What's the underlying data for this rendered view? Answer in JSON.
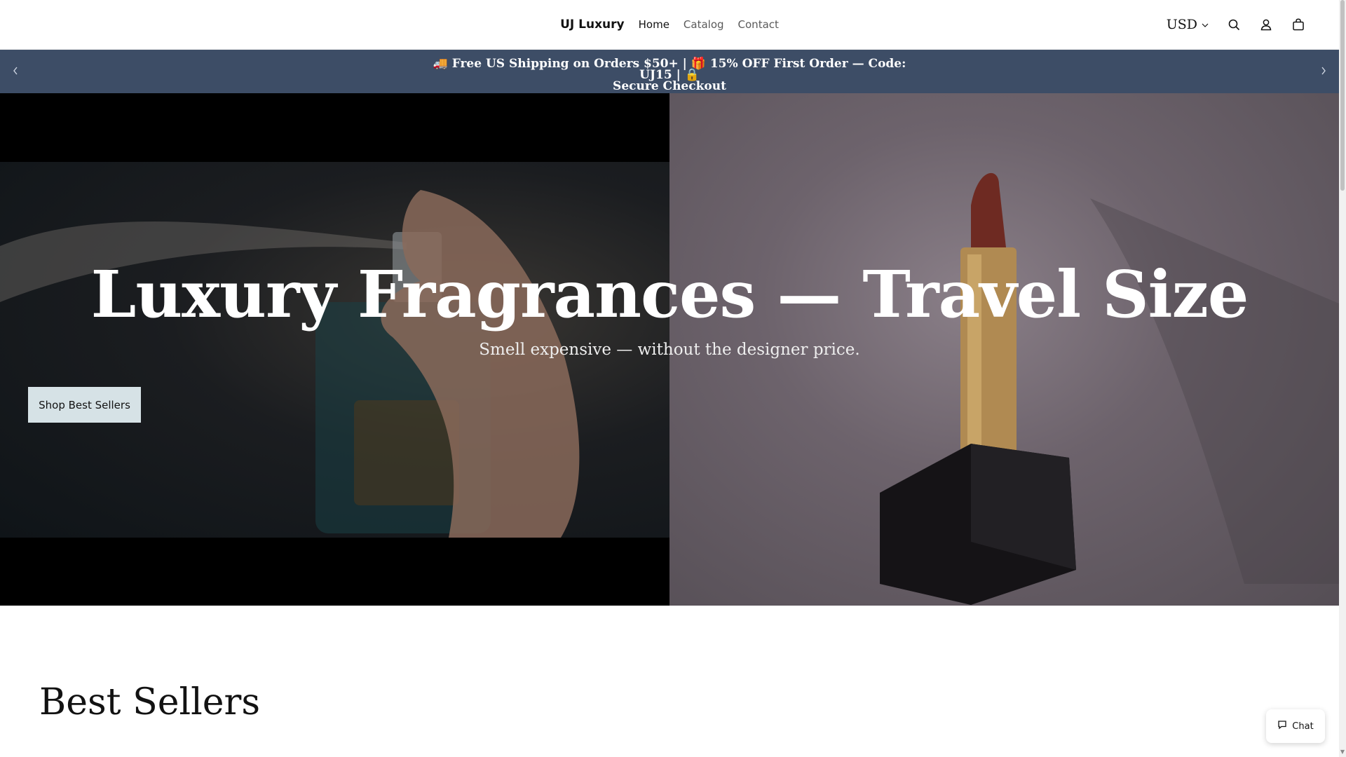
{
  "header": {
    "logo": "UJ Luxury",
    "nav": [
      {
        "label": "Home",
        "active": true
      },
      {
        "label": "Catalog",
        "active": false
      },
      {
        "label": "Contact",
        "active": false
      }
    ],
    "currency": "USD",
    "icons": [
      "search-icon",
      "account-icon",
      "cart-icon"
    ]
  },
  "announcement": {
    "line1": "🚚 Free US Shipping on Orders $50+ | 🎁 15% OFF First Order — Code: UJ15 | 🔒",
    "line2": "Secure Checkout"
  },
  "hero": {
    "title": "Luxury Fragrances — Travel Size",
    "subtitle": "Smell expensive — without the designer price.",
    "button": "Shop Best Sellers"
  },
  "section": {
    "title": "Best Sellers"
  },
  "chat": {
    "label": "Chat"
  },
  "colors": {
    "announcement_bg": "#3d4d66",
    "button_bg": "#d6e2e6"
  }
}
